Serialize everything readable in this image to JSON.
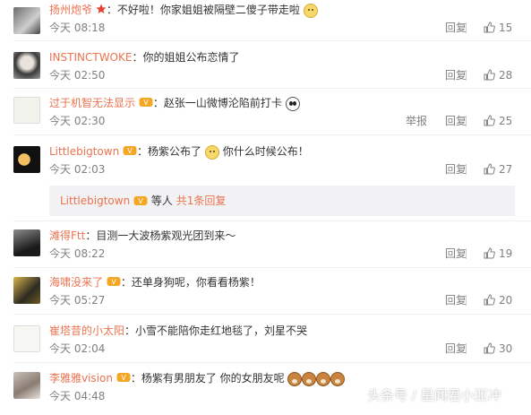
{
  "comments": [
    {
      "user": "扬州炮爷",
      "text": "：不好啦！你家姐姐被隔壁二傻子带走啦",
      "time": "今天 08:18",
      "reply": "回复",
      "likes": "15",
      "badge": "star",
      "emoji": [
        "dog"
      ]
    },
    {
      "user": "INSTINCTWOKE",
      "text": "：你的姐姐公布恋情了",
      "time": "今天 02:50",
      "reply": "回复",
      "likes": "28",
      "badge": "",
      "emoji": []
    },
    {
      "user": "过于机智无法显示",
      "text": "：赵张一山微博沦陷前打卡",
      "time": "今天 02:30",
      "reply": "回复",
      "report": "举报",
      "likes": "25",
      "badge": "vip",
      "emoji": [
        "panda"
      ]
    },
    {
      "user": "Littlebigtown",
      "text": "：杨紫公布了",
      "text2": "你什么时候公布！",
      "time": "今天 02:03",
      "reply": "回复",
      "likes": "27",
      "badge": "vip",
      "emoji": [
        "dog"
      ]
    },
    {
      "user": "滩得Ftt",
      "text": "：目测一大波杨紫观光团到来～",
      "time": "今天 08:22",
      "reply": "回复",
      "likes": "19",
      "badge": "",
      "emoji": []
    },
    {
      "user": "海啸没来了",
      "text": "：还单身狗呢，你看看杨紫！",
      "time": "今天 05:27",
      "reply": "回复",
      "likes": "20",
      "badge": "vip",
      "emoji": []
    },
    {
      "user": "崔塔昔的小太阳",
      "text": "：小雪不能陪你走红地毯了，刘星不哭",
      "time": "今天 02:04",
      "reply": "回复",
      "likes": "30",
      "badge": "",
      "emoji": []
    },
    {
      "user": "李雅雅vision",
      "text": "：杨紫有男朋友了 你的女朋友呢",
      "time": "今天 04:48",
      "reply": "回复",
      "likes": "",
      "badge": "vip",
      "emoji": [
        "shiba",
        "shiba",
        "shiba",
        "shiba"
      ]
    }
  ],
  "more_replies": {
    "user": "Littlebigtown",
    "suffix": "等人",
    "link": "共1条回复"
  },
  "watermark": "头条号 / 星闻君小亚冲",
  "colors": {
    "username": "#eb7350",
    "meta": "#808080",
    "panel": "#f2f2f5"
  }
}
